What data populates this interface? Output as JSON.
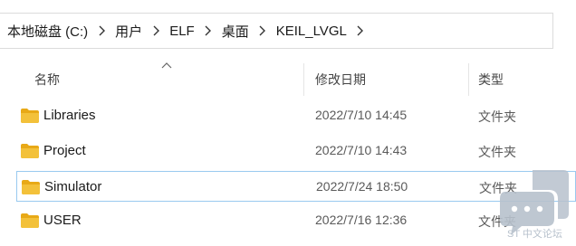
{
  "address_bar": {
    "crumbs": [
      "本地磁盘 (C:)",
      "用户",
      "ELF",
      "桌面",
      "KEIL_LVGL"
    ]
  },
  "columns": {
    "name": "名称",
    "modified": "修改日期",
    "type": "类型"
  },
  "files": [
    {
      "name": "Libraries",
      "modified": "2022/7/10 14:45",
      "type": "文件夹",
      "selected": false
    },
    {
      "name": "Project",
      "modified": "2022/7/10 14:43",
      "type": "文件夹",
      "selected": false
    },
    {
      "name": "Simulator",
      "modified": "2022/7/24 18:50",
      "type": "文件夹",
      "selected": true
    },
    {
      "name": "USER",
      "modified": "2022/7/16 12:36",
      "type": "文件夹",
      "selected": false
    }
  ],
  "icons": {
    "folder": "folder-icon",
    "separator": "chevron-right-icon",
    "sort": "sort-ascending-icon"
  },
  "colors": {
    "folder": "#f3c13a",
    "selection_border": "#99c9ef",
    "watermark": "#b7c1cc"
  },
  "watermark": {
    "text": "ST 中文论坛"
  }
}
